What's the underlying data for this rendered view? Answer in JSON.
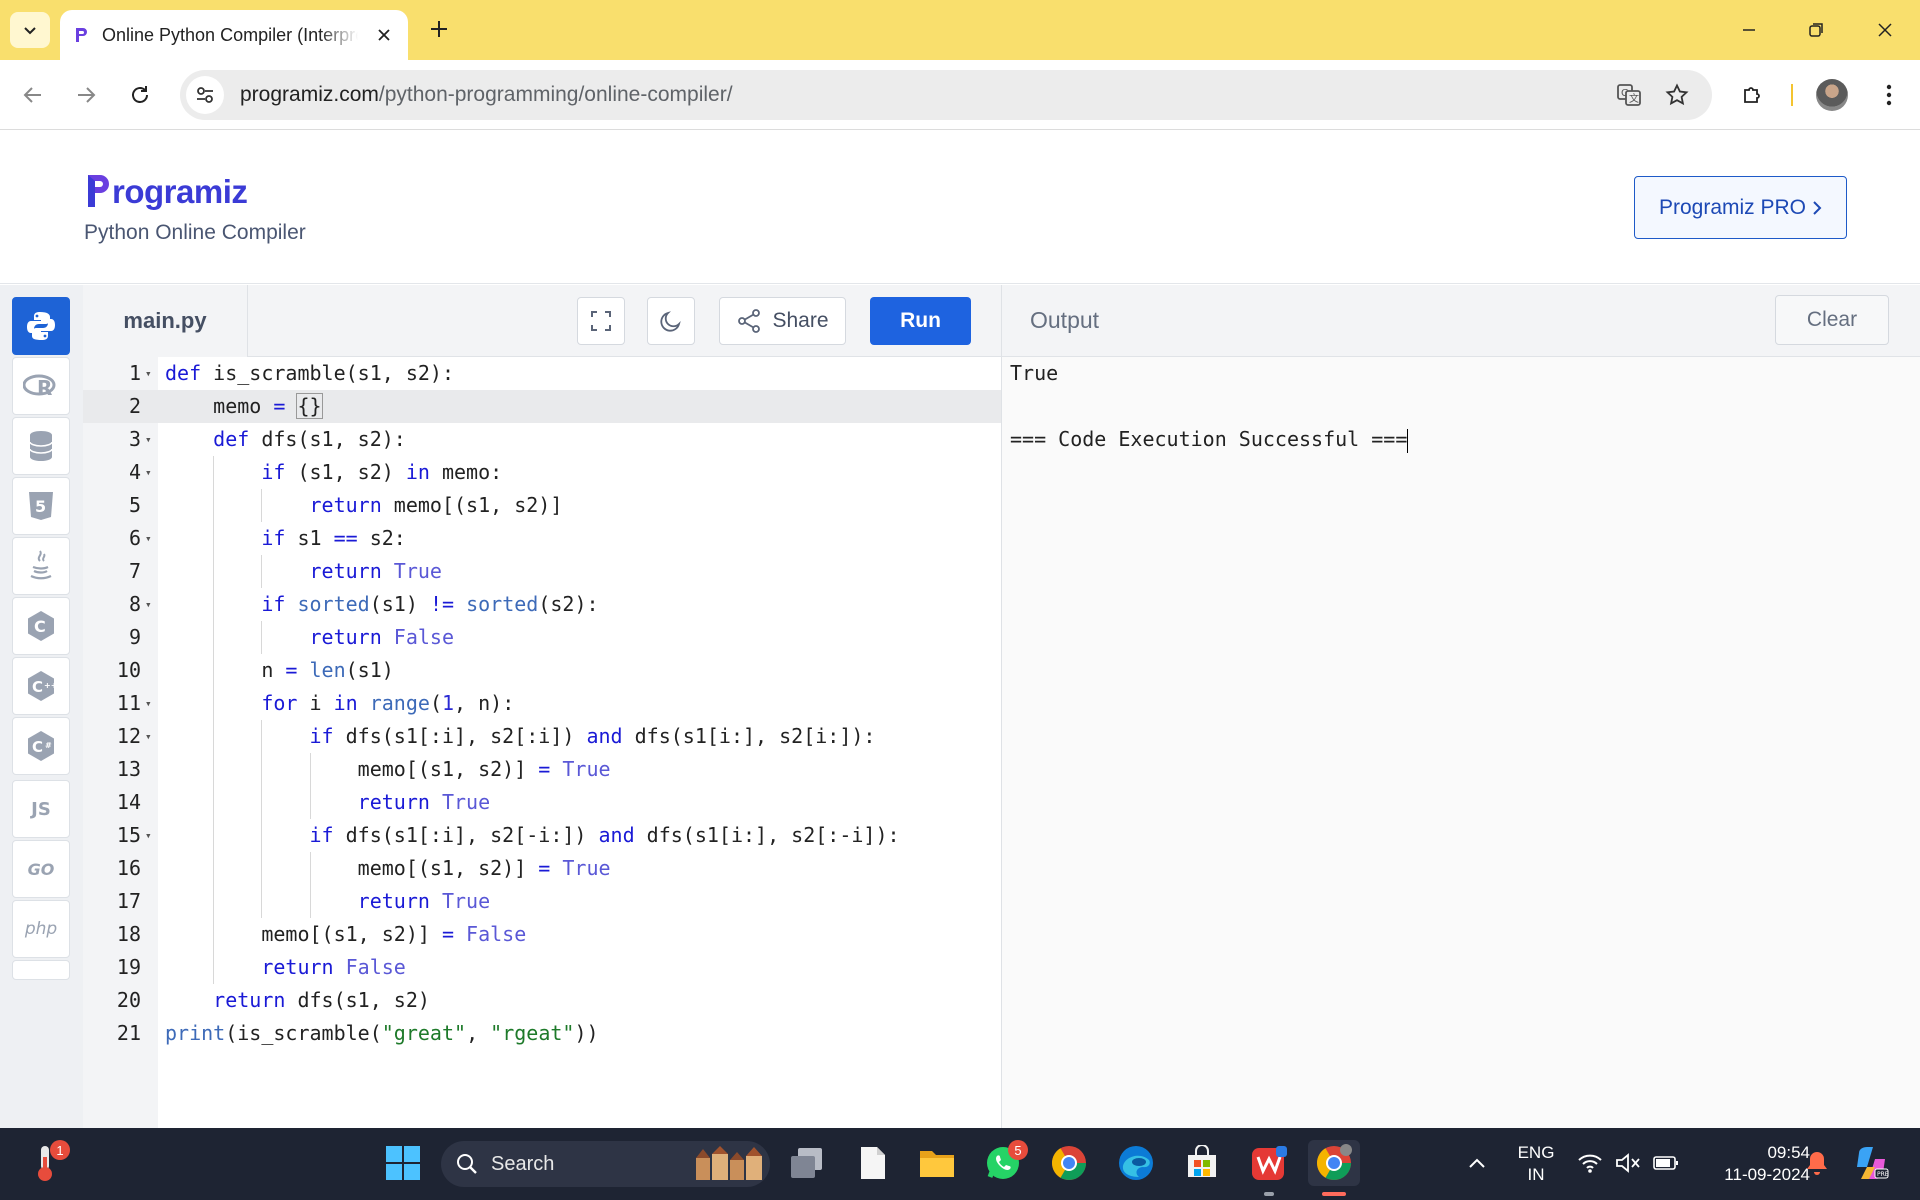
{
  "browser": {
    "tab_title": "Online Python Compiler (Interpreter)",
    "url_host": "programiz.com",
    "url_path": "/python-programming/online-compiler/"
  },
  "header": {
    "logo_text": "rogramiz",
    "subtitle": "Python Online Compiler",
    "pro_button": "Programiz PRO"
  },
  "rail": {
    "items": [
      {
        "name": "python",
        "label": ""
      },
      {
        "name": "r",
        "label": "R"
      },
      {
        "name": "sql",
        "label": ""
      },
      {
        "name": "html",
        "label": "5"
      },
      {
        "name": "java",
        "label": ""
      },
      {
        "name": "c",
        "label": "C"
      },
      {
        "name": "cpp",
        "label": "C"
      },
      {
        "name": "csharp",
        "label": "C"
      },
      {
        "name": "js",
        "label": "JS"
      },
      {
        "name": "go",
        "label": "GO"
      },
      {
        "name": "php",
        "label": "php"
      }
    ]
  },
  "editor": {
    "filename": "main.py",
    "share_label": "Share",
    "run_label": "Run",
    "highlighted_line": 2,
    "lines": [
      {
        "n": "1",
        "fold": true
      },
      {
        "n": "2",
        "fold": false
      },
      {
        "n": "3",
        "fold": true
      },
      {
        "n": "4",
        "fold": true
      },
      {
        "n": "5",
        "fold": false
      },
      {
        "n": "6",
        "fold": true
      },
      {
        "n": "7",
        "fold": false
      },
      {
        "n": "8",
        "fold": true
      },
      {
        "n": "9",
        "fold": false
      },
      {
        "n": "10",
        "fold": false
      },
      {
        "n": "11",
        "fold": true
      },
      {
        "n": "12",
        "fold": true
      },
      {
        "n": "13",
        "fold": false
      },
      {
        "n": "14",
        "fold": false
      },
      {
        "n": "15",
        "fold": true
      },
      {
        "n": "16",
        "fold": false
      },
      {
        "n": "17",
        "fold": false
      },
      {
        "n": "18",
        "fold": false
      },
      {
        "n": "19",
        "fold": false
      },
      {
        "n": "20",
        "fold": false
      },
      {
        "n": "21",
        "fold": false
      }
    ],
    "code": [
      "def is_scramble(s1, s2):",
      "    memo = {}",
      "    def dfs(s1, s2):",
      "        if (s1, s2) in memo:",
      "            return memo[(s1, s2)]",
      "        if s1 == s2:",
      "            return True",
      "        if sorted(s1) != sorted(s2):",
      "            return False",
      "        n = len(s1)",
      "        for i in range(1, n):",
      "            if dfs(s1[:i], s2[:i]) and dfs(s1[i:], s2[i:]):",
      "                memo[(s1, s2)] = True",
      "                return True",
      "            if dfs(s1[:i], s2[-i:]) and dfs(s1[i:], s2[:-i]):",
      "                memo[(s1, s2)] = True",
      "                return True",
      "        memo[(s1, s2)] = False",
      "        return False",
      "    return dfs(s1, s2)",
      "print(is_scramble(\"great\", \"rgeat\"))"
    ]
  },
  "output": {
    "title": "Output",
    "clear_label": "Clear",
    "lines": [
      "True",
      "",
      "=== Code Execution Successful ==="
    ]
  },
  "taskbar": {
    "search_placeholder": "Search",
    "weather_badge": "1",
    "whatsapp_badge": "5",
    "lang_top": "ENG",
    "lang_bottom": "IN",
    "time": "09:54",
    "date": "11-09-2024"
  }
}
